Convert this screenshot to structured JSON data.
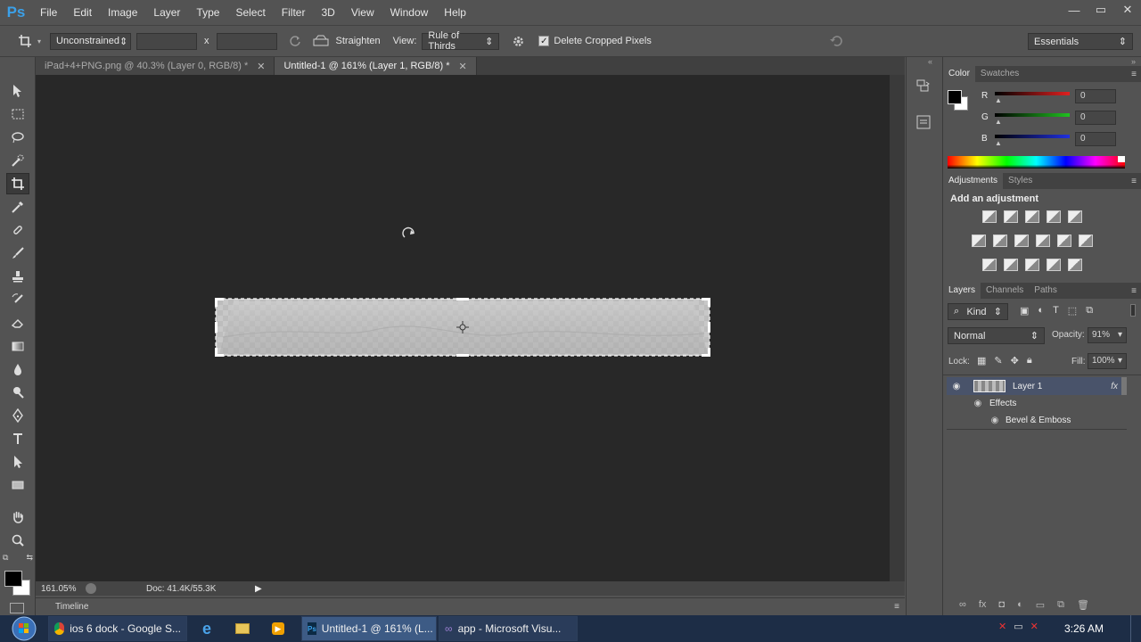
{
  "app": {
    "logo": "Ps"
  },
  "menu": [
    "File",
    "Edit",
    "Image",
    "Layer",
    "Type",
    "Select",
    "Filter",
    "3D",
    "View",
    "Window",
    "Help"
  ],
  "window_controls": {
    "minimize": "—",
    "restore": "▭",
    "close": "✕"
  },
  "options": {
    "ratio_select": "Unconstrained",
    "width_value": "",
    "times": "x",
    "height_value": "",
    "straighten_label": "Straighten",
    "view_label": "View:",
    "view_select": "Rule of Thirds",
    "delete_cropped_label": "Delete Cropped Pixels",
    "delete_cropped_checked": true,
    "workspace_select": "Essentials"
  },
  "tabs": [
    {
      "label": "iPad+4+PNG.png @ 40.3% (Layer 0, RGB/8) *",
      "active": false
    },
    {
      "label": "Untitled-1 @ 161% (Layer 1, RGB/8) *",
      "active": true
    }
  ],
  "status": {
    "zoom": "161.05%",
    "doc": "Doc: 41.4K/55.3K"
  },
  "timeline": {
    "label": "Timeline"
  },
  "color_panel": {
    "tabs": [
      "Color",
      "Swatches"
    ],
    "channels": [
      {
        "label": "R",
        "value": "0",
        "color": "#e02020"
      },
      {
        "label": "G",
        "value": "0",
        "color": "#20c020"
      },
      {
        "label": "B",
        "value": "0",
        "color": "#2030e0"
      }
    ]
  },
  "adjustments_panel": {
    "tabs": [
      "Adjustments",
      "Styles"
    ],
    "heading": "Add an adjustment",
    "icons": [
      "brightness-icon",
      "levels-icon",
      "curves-icon",
      "exposure-icon",
      "vibrance-icon",
      "hue-saturation-icon",
      "color-balance-icon",
      "black-white-icon",
      "photo-filter-icon",
      "channel-mixer-icon",
      "color-lookup-icon",
      "invert-icon",
      "posterize-icon",
      "threshold-icon",
      "gradient-map-icon",
      "selective-color-icon"
    ]
  },
  "layers_panel": {
    "tabs": [
      "Layers",
      "Channels",
      "Paths"
    ],
    "kind": "Kind",
    "blend_mode": "Normal",
    "opacity_label": "Opacity:",
    "opacity": "91%",
    "lock_label": "Lock:",
    "fill_label": "Fill:",
    "fill": "100%",
    "layers": [
      {
        "name": "Layer 1",
        "fx": "fx"
      }
    ],
    "effects_label": "Effects",
    "effect_items": [
      "Bevel & Emboss"
    ]
  },
  "taskbar": {
    "items": [
      {
        "label": "ios 6 dock - Google S..."
      },
      {
        "label": "Untitled-1 @ 161% (L..."
      },
      {
        "label": "app - Microsoft Visu..."
      }
    ],
    "clock": "3:26 AM"
  }
}
